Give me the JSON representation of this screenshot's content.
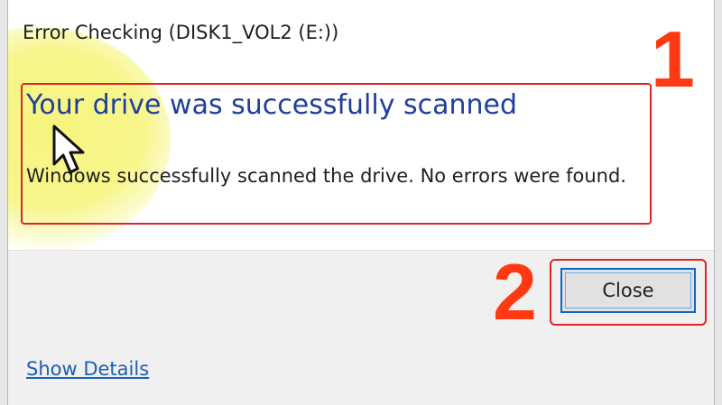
{
  "window": {
    "title": "Error Checking (DISK1_VOL2 (E:))"
  },
  "content": {
    "heading": "Your drive was successfully scanned",
    "message": "Windows successfully scanned the drive. No errors were found."
  },
  "buttons": {
    "close_label": "Close"
  },
  "links": {
    "show_details": "Show Details"
  },
  "annotations": {
    "marker_1": "1",
    "marker_2": "2",
    "accent_color": "#ff3a12",
    "frame_color": "#e02424"
  },
  "icons": {
    "cursor": "mouse-pointer-icon"
  }
}
